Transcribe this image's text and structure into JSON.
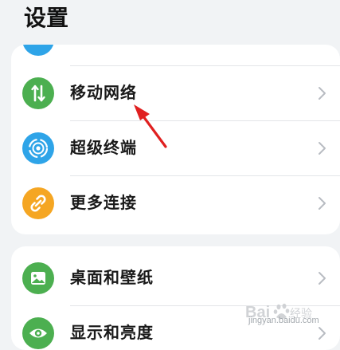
{
  "header": {
    "title": "设置"
  },
  "sections": [
    {
      "items": [
        {
          "label": "移动网络",
          "icon": "mobile-data-icon",
          "color": "#4caf50"
        },
        {
          "label": "超级终端",
          "icon": "super-device-icon",
          "color": "#2ea4e8"
        },
        {
          "label": "更多连接",
          "icon": "link-icon",
          "color": "#f5a623"
        }
      ]
    },
    {
      "items": [
        {
          "label": "桌面和壁纸",
          "icon": "wallpaper-icon",
          "color": "#4caf50"
        },
        {
          "label": "显示和亮度",
          "icon": "eye-icon",
          "color": "#4caf50"
        }
      ]
    }
  ],
  "watermark": {
    "text": "jingyan.baidu.com"
  }
}
